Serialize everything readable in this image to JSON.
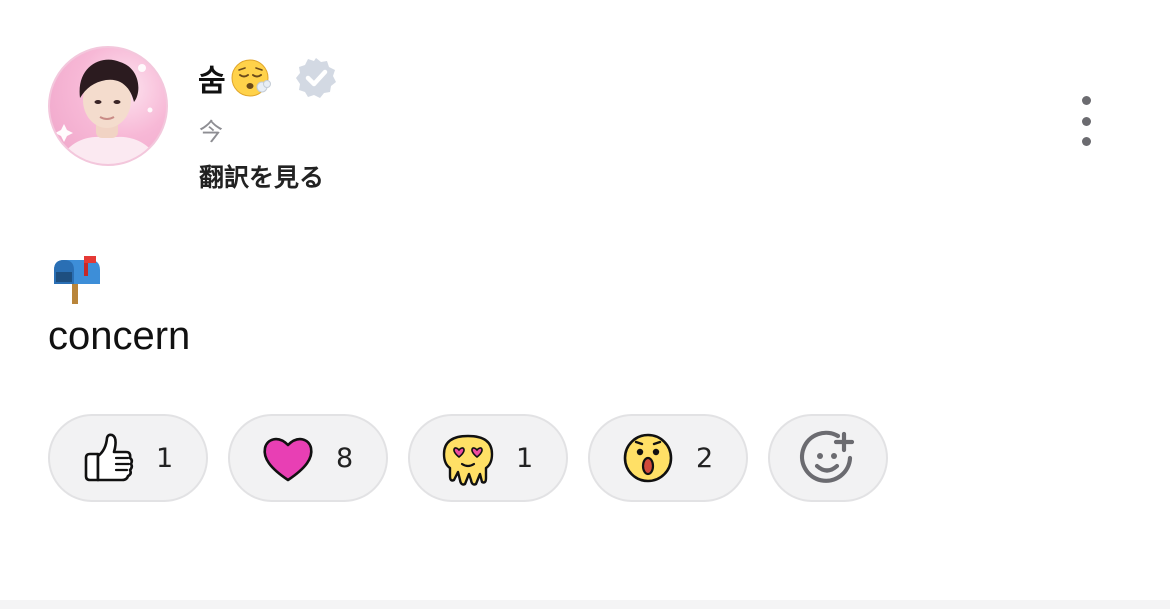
{
  "post": {
    "author": {
      "name": "숨",
      "name_emoji_icon": "face-exhaling-emoji",
      "verified_icon": "verified-badge-icon"
    },
    "time": "今",
    "translate_label": "翻訳を見る",
    "content_icon": "mailbox-flag-up-emoji",
    "content_text": "concern",
    "menu_icon": "more-vertical-icon"
  },
  "reactions": [
    {
      "icon": "thumbs-up-icon",
      "count": "1"
    },
    {
      "icon": "heart-icon",
      "count": "8"
    },
    {
      "icon": "melting-heart-eyes-icon",
      "count": "1"
    },
    {
      "icon": "surprised-face-icon",
      "count": "2"
    }
  ],
  "add_reaction_icon": "add-reaction-icon",
  "colors": {
    "pill_bg": "#f2f2f3",
    "pill_border": "#e2e2e4",
    "heart": "#e83fb4",
    "emoji_yellow": "#ffe066",
    "verified_badge": "#d3d9e3",
    "muted_text": "#8e8e93"
  }
}
